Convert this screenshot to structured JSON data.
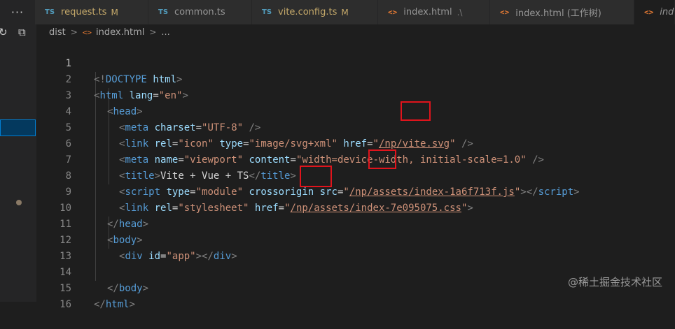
{
  "tabs": [
    {
      "badge": "TS",
      "label": "request.ts",
      "mod": "M",
      "path": ""
    },
    {
      "badge": "TS",
      "label": "common.ts",
      "mod": "",
      "path": ""
    },
    {
      "badge": "TS",
      "label": "vite.config.ts",
      "mod": "M",
      "path": ""
    },
    {
      "badge": "<>",
      "label": "index.html",
      "mod": "",
      "path": ".\\"
    },
    {
      "badge": "<>",
      "label": "index.html (工作树)",
      "mod": "",
      "path": ""
    },
    {
      "badge": "<>",
      "label": "ind",
      "mod": "",
      "path": ""
    }
  ],
  "tab_overflow": "···",
  "sidebar": {
    "refresh_icon": "↻",
    "collapse_icon": "⧉"
  },
  "breadcrumb": {
    "folder": "dist",
    "file": "index.html",
    "more": "..."
  },
  "editor": {
    "line_numbers": [
      "1",
      "2",
      "3",
      "4",
      "5",
      "6",
      "7",
      "8",
      "9",
      "10",
      "11",
      "12",
      "13",
      "14",
      "15",
      "16"
    ],
    "current_line": 1,
    "lines": {
      "l1": {
        "p1": "<!",
        "kw": "DOCTYPE",
        "sp": " ",
        "attr": "html",
        "p2": ">"
      },
      "l2": {
        "p1": "<",
        "tag": "html",
        "sp": " ",
        "attr": "lang",
        "eq": "=",
        "str": "\"en\"",
        "p2": ">"
      },
      "l3": {
        "p1": "<",
        "tag": "head",
        "p2": ">"
      },
      "l4": {
        "p1": "<",
        "tag": "meta",
        "sp": " ",
        "attr": "charset",
        "eq": "=",
        "str": "\"UTF-8\"",
        "p2": " />"
      },
      "l5": {
        "p1": "<",
        "tag": "link",
        "a1": "rel",
        "s1": "\"icon\"",
        "a2": "type",
        "s2": "\"image/svg+xml\"",
        "a3": "href",
        "q1": "\"",
        "link": "/np/vite.svg",
        "q2": "\"",
        "p2": " />"
      },
      "l6": {
        "p1": "<",
        "tag": "meta",
        "a1": "name",
        "s1": "\"viewport\"",
        "a2": "content",
        "s2": "\"width=device-width, initial-scale=1.0\"",
        "p2": " />"
      },
      "l7": {
        "p1": "<",
        "tag": "title",
        "p2": ">",
        "text": "Vite + Vue + TS",
        "p3": "</",
        "tag2": "title",
        "p4": ">"
      },
      "l8": {
        "p1": "<",
        "tag": "script",
        "a1": "type",
        "s1": "\"module\"",
        "a2": "crossorigin",
        "a3": "src",
        "q1": "\"",
        "link": "/np/assets/index-1a6f713f.js",
        "q2": "\"",
        "p2": "></",
        "tag2": "script",
        "p3": ">"
      },
      "l9": {
        "p1": "<",
        "tag": "link",
        "a1": "rel",
        "s1": "\"stylesheet\"",
        "a2": "href",
        "q1": "\"",
        "link": "/np/assets/index-7e095075.css",
        "q2": "\"",
        "p2": ">"
      },
      "l10": {
        "p1": "</",
        "tag": "head",
        "p2": ">"
      },
      "l11": {
        "p1": "<",
        "tag": "body",
        "p2": ">"
      },
      "l12": {
        "p1": "<",
        "tag": "div",
        "a1": "id",
        "s1": "\"app\"",
        "p2": "></",
        "tag2": "div",
        "p3": ">"
      },
      "l14": {
        "p1": "</",
        "tag": "body",
        "p2": ">"
      },
      "l15": {
        "p1": "</",
        "tag": "html",
        "p2": ">"
      }
    }
  },
  "colors": {
    "accent_highlight": "#e0141c",
    "tag": "#569cd6",
    "attr": "#9cdcfe",
    "string": "#ce9178"
  },
  "watermark": "@稀土掘金技术社区"
}
